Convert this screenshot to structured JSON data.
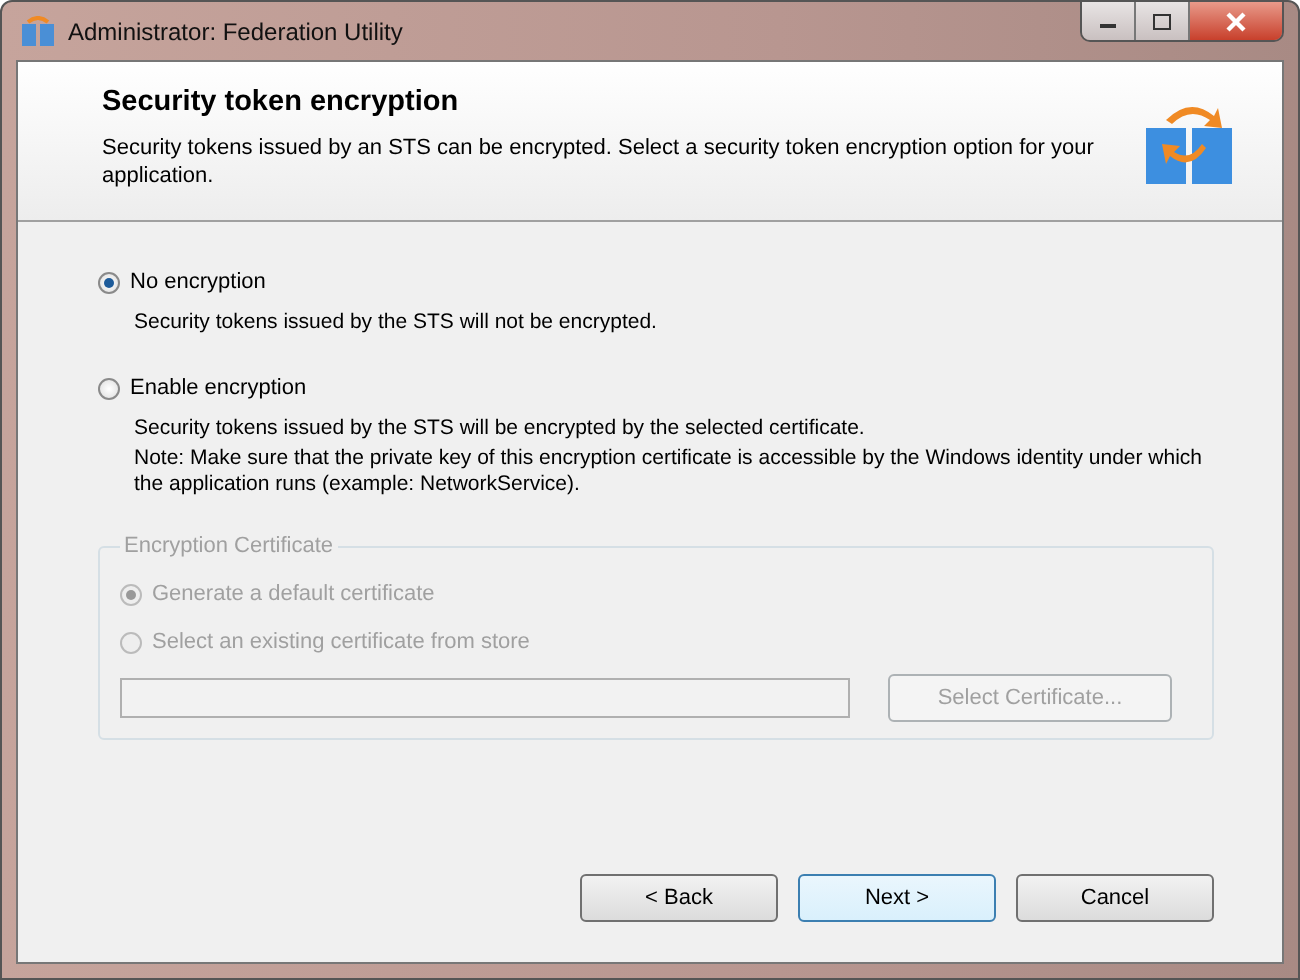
{
  "window": {
    "title": "Administrator: Federation Utility"
  },
  "header": {
    "title": "Security token encryption",
    "description": "Security tokens issued by an STS can be encrypted. Select a security token encryption option for your application."
  },
  "options": [
    {
      "label": "No encryption",
      "selected": true,
      "notes": [
        "Security tokens issued by the STS will not be encrypted."
      ]
    },
    {
      "label": "Enable encryption",
      "selected": false,
      "notes": [
        "Security tokens issued by the STS will be encrypted by the selected certificate.",
        "Note: Make sure that the private key of this encryption certificate is accessible by the Windows identity under which the application runs (example: NetworkService)."
      ]
    }
  ],
  "certificate_group": {
    "legend": "Encryption Certificate",
    "disabled": true,
    "options": [
      {
        "label": "Generate a default certificate",
        "selected": true
      },
      {
        "label": "Select an existing certificate from store",
        "selected": false
      }
    ],
    "button": "Select Certificate..."
  },
  "buttons": [
    {
      "label": "< Back",
      "focused": false
    },
    {
      "label": "Next >",
      "focused": true
    },
    {
      "label": "Cancel",
      "focused": false
    }
  ]
}
